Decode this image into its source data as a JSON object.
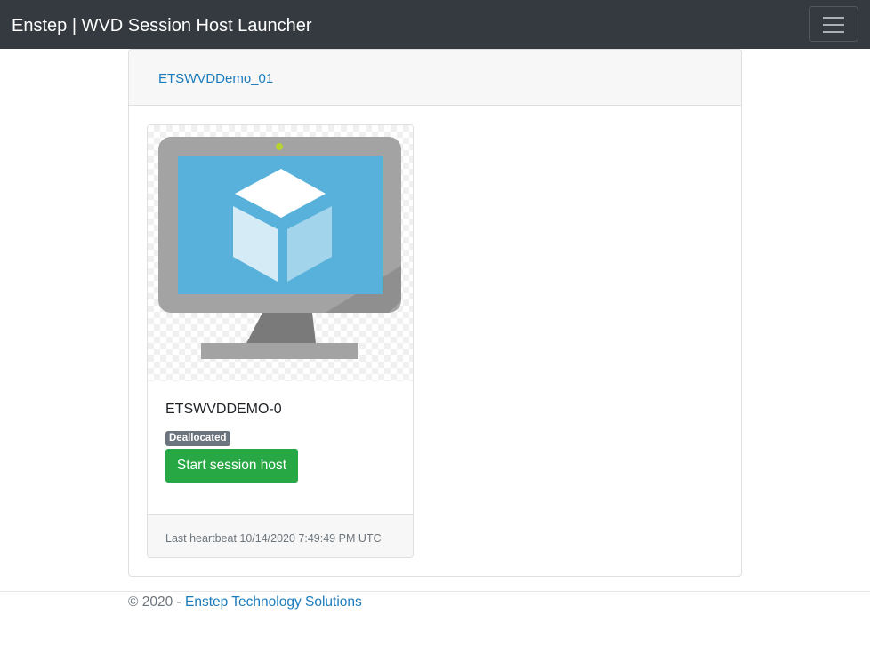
{
  "app": {
    "title": "Enstep | WVD Session Host Launcher",
    "menu_icon": "hamburger-menu-icon"
  },
  "host_pool": {
    "name": "ETSWVDDemo_01"
  },
  "session_hosts": [
    {
      "name": "ETSWVDDEMO-0",
      "status": "Deallocated",
      "status_color": "#6c757d",
      "action_label": "Start session host",
      "action_color": "#28a745",
      "heartbeat": "Last heartbeat 10/14/2020 7:49:49 PM UTC",
      "image_icon": "azure-virtual-machine-icon"
    }
  ],
  "footer": {
    "copyright": "© 2020 -",
    "company": "Enstep Technology Solutions"
  },
  "colors": {
    "navbar": "#343a40",
    "link": "#1a7bbd"
  }
}
